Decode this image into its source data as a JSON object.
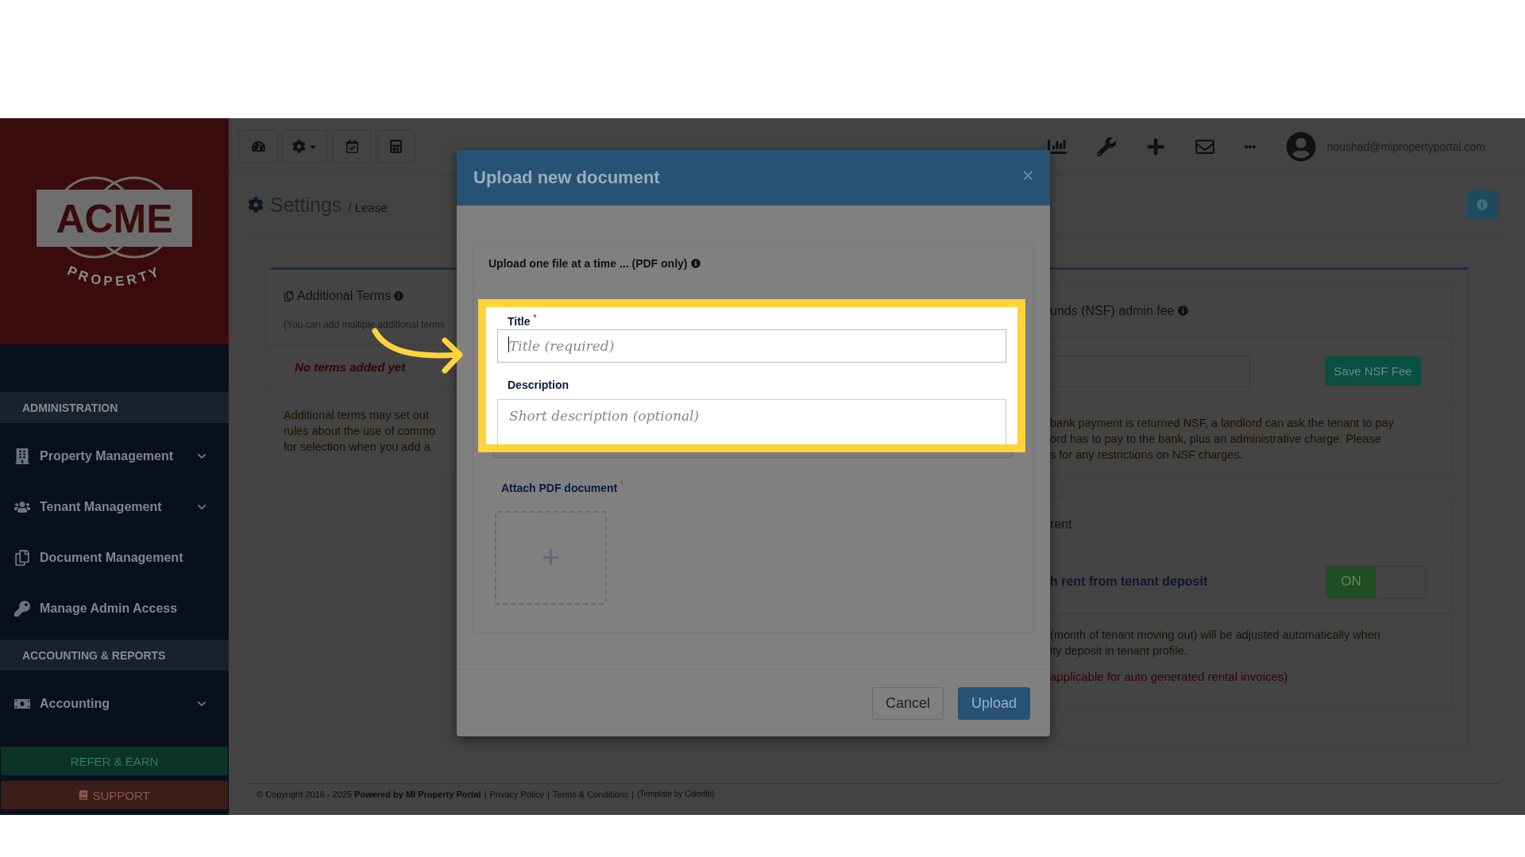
{
  "sidebar": {
    "logo": {
      "word": "ACME",
      "subtitle": "PROPERTY"
    },
    "sections": [
      {
        "heading": "ADMINISTRATION",
        "items": [
          {
            "label": "Property Management",
            "expandable": true
          },
          {
            "label": "Tenant Management",
            "expandable": true
          },
          {
            "label": "Document Management",
            "expandable": false
          },
          {
            "label": "Manage Admin Access",
            "expandable": false
          }
        ]
      },
      {
        "heading": "ACCOUNTING & REPORTS",
        "items": [
          {
            "label": "Accounting",
            "expandable": true
          }
        ]
      }
    ],
    "refer_button": "REFER & EARN",
    "support_button": "SUPPORT"
  },
  "topbar": {
    "user_email": "noushad@mipropertyportal.com"
  },
  "page": {
    "title": "Settings",
    "breadcrumb": "/ Lease"
  },
  "additional_terms": {
    "title": "Additional Terms",
    "note": "(You can add multiple additional terms",
    "empty": "No terms added yet",
    "text_lines": [
      "Additional terms may set out",
      "rules about the use of commo",
      "for selection when you add a"
    ]
  },
  "nsf": {
    "title": "unds (NSF) admin fee",
    "save_button": "Save NSF Fee",
    "text_lines": [
      "bank payment is returned NSF, a landlord can ask the tenant to pay",
      "ord has to pay to the bank, plus an administrative charge. Please",
      "s for any restrictions on NSF charges."
    ]
  },
  "last_rent": {
    "title": "rent",
    "option": "h rent from tenant deposit",
    "toggle": {
      "on": true,
      "label": "ON"
    },
    "text_lines": [
      "(month of tenant moving out) will be adjusted automatically when",
      "ity deposit in tenant profile."
    ],
    "warning": "applicable for auto generated rental invoices)"
  },
  "footer": [
    {
      "kind": "text",
      "text": "© Copyright 2016 - 2025 **Powered by MI Property Portal**"
    },
    {
      "kind": "sep",
      "text": "|"
    },
    {
      "kind": "link",
      "text": "Privacy Policy"
    },
    {
      "kind": "sep",
      "text": "|"
    },
    {
      "kind": "link",
      "text": "Terms & Conditions"
    },
    {
      "kind": "sep",
      "text": "|"
    },
    {
      "kind": "small",
      "text": "(Template by Colorlib)"
    }
  ],
  "modal": {
    "title": "Upload new document",
    "close": "×",
    "instructions": "Upload one file at a time ... (PDF only)",
    "fields": [
      {
        "label": "Title $^{*}$",
        "placeholder": "Title (required)",
        "focused": true,
        "kind": "input"
      },
      {
        "label": "Description",
        "placeholder": "Short description (optional)",
        "focused": false,
        "kind": "textarea"
      }
    ],
    "attach_label": "Attach PDF document $^{*}$",
    "dropzone": "+",
    "buttons": [
      {
        "label": "Cancel",
        "kind": "secondary"
      },
      {
        "label": "Upload",
        "kind": "primary"
      }
    ]
  }
}
